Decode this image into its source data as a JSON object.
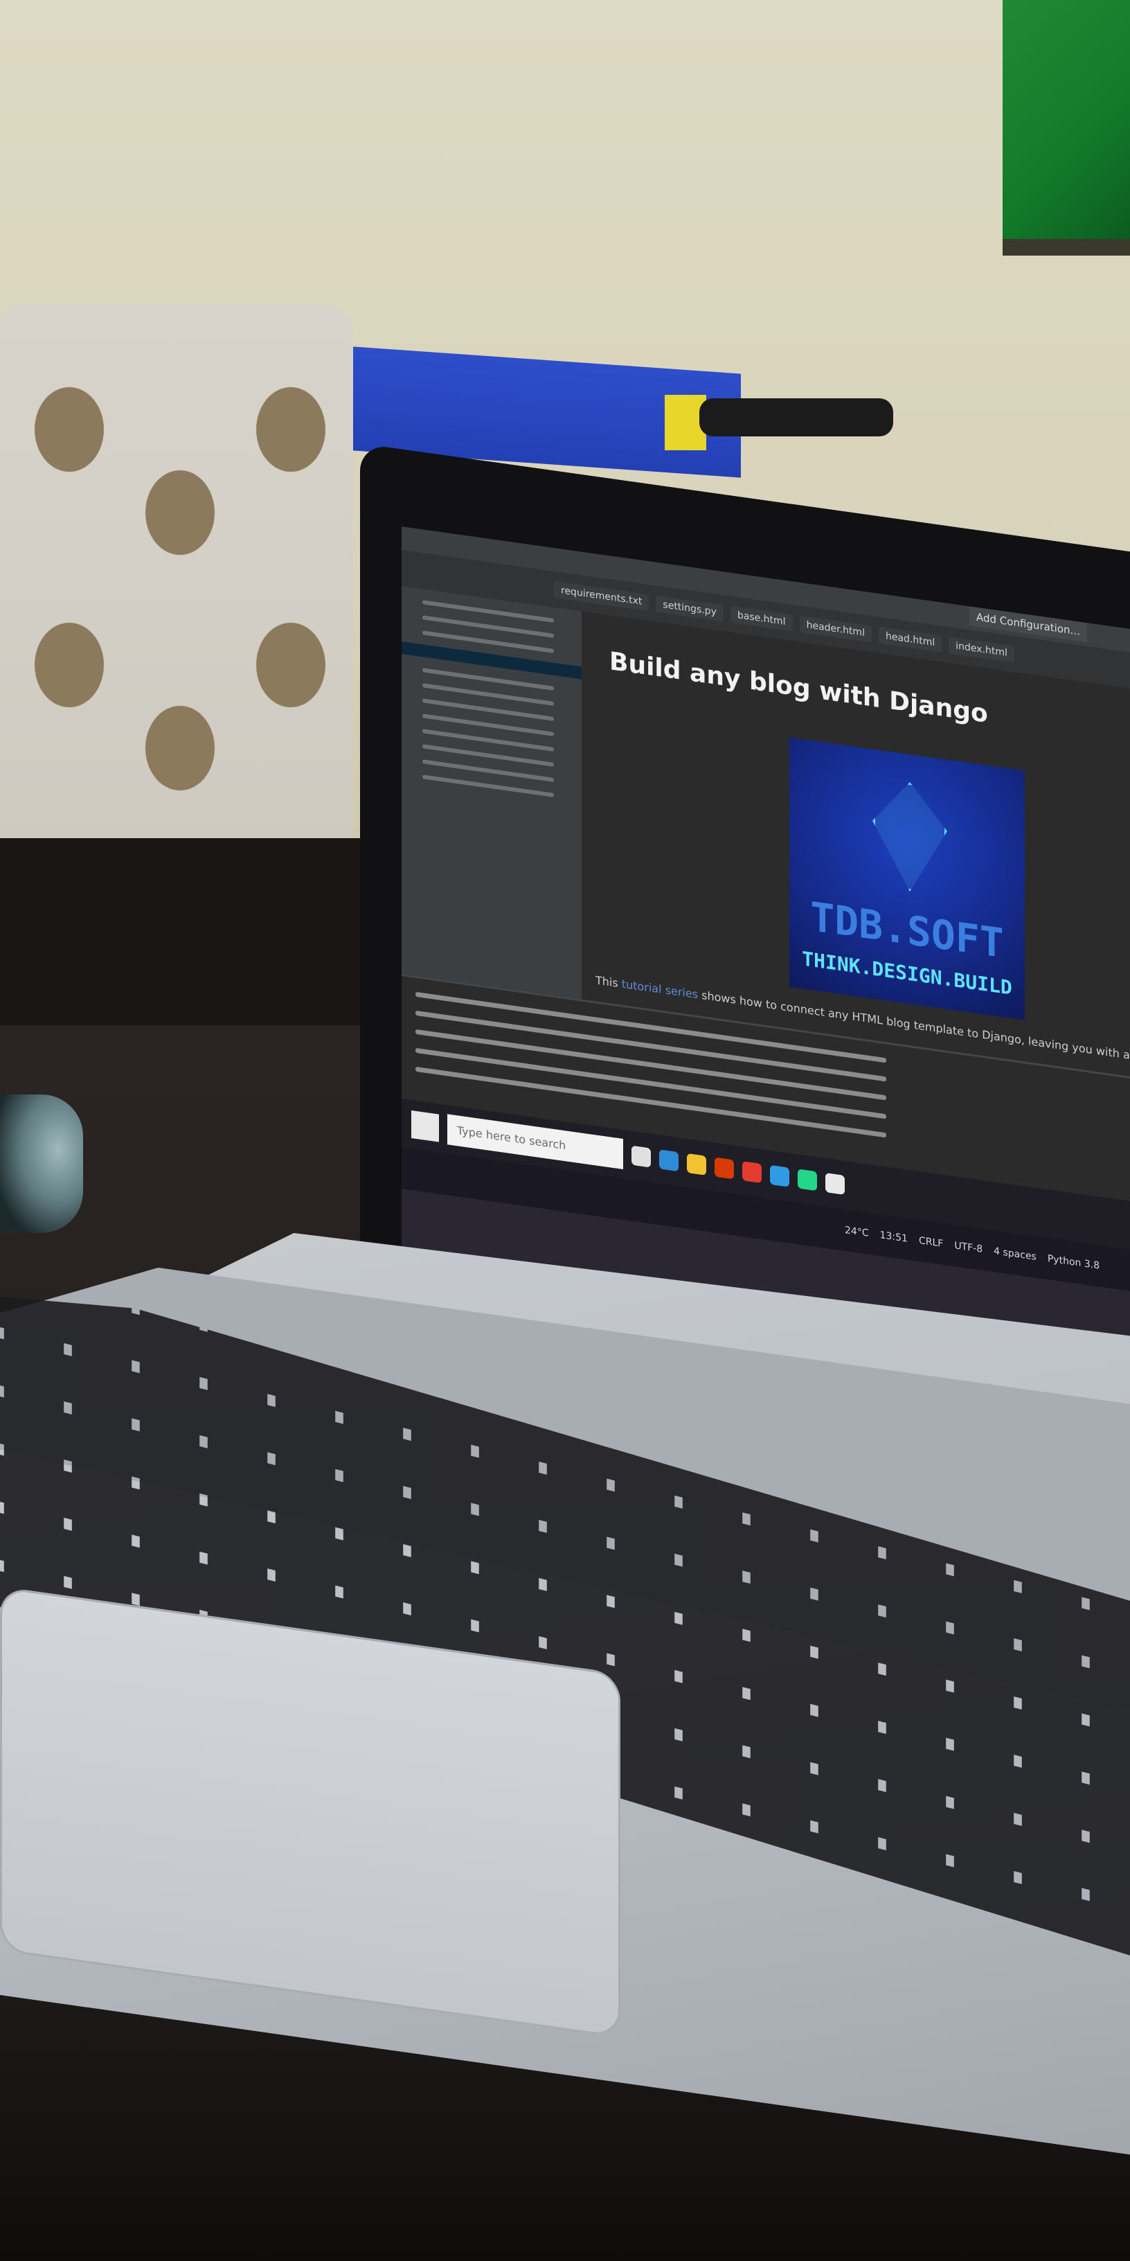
{
  "ide": {
    "add_configuration": "Add Configuration...",
    "tabs": [
      "requirements.txt",
      "settings.py",
      "base.html",
      "header.html",
      "head.html",
      "index.html"
    ]
  },
  "preview": {
    "title": "Build any blog with Django",
    "logo_name": "TDB.SOFT",
    "logo_tagline": "THINK.DESIGN.BUILD",
    "description_prefix": "This",
    "description_link": "tutorial series",
    "description": "shows how to connect any HTML blog template to Django, leaving you with an awesome looking, fully-fu"
  },
  "taskbar": {
    "search_placeholder": "Type here to search"
  },
  "statusbar": {
    "time": "13:51",
    "line_ending": "CRLF",
    "encoding": "UTF-8",
    "indent": "4 spaces",
    "interpreter": "Python 3.8",
    "temperature": "24°C"
  },
  "colors": {
    "ide_bg": "#2b2b2b",
    "logo_blue": "#152b8c",
    "wall": "#ded9c2",
    "laptop_silver": "#c7cbd0"
  }
}
